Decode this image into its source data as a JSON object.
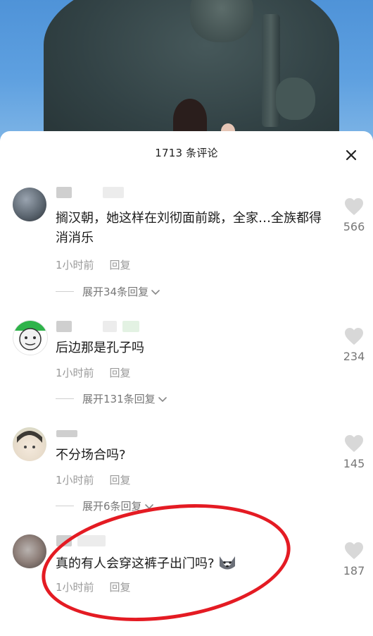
{
  "header": {
    "comment_count_title": "1713 条评论"
  },
  "comments": [
    {
      "text": "搁汉朝，她这样在刘彻面前跳，全家…全族都得消消乐",
      "time": "1小时前",
      "reply_label": "回复",
      "expand_label": "展开34条回复",
      "likes": "566"
    },
    {
      "text": "后边那是孔子吗",
      "time": "1小时前",
      "reply_label": "回复",
      "expand_label": "展开131条回复",
      "likes": "234"
    },
    {
      "text": "不分场合吗?",
      "time": "1小时前",
      "reply_label": "回复",
      "expand_label": "展开6条回复",
      "likes": "145"
    },
    {
      "text": "真的有人会穿这裤子出门吗?",
      "time": "1小时前",
      "reply_label": "回复",
      "likes": "187"
    }
  ],
  "colors": {
    "annotation_circle": "#e41b23",
    "like_icon": "#d8d8d8"
  },
  "icons": {
    "close": "close-icon",
    "like": "heart-icon",
    "expand": "chevron-down-icon",
    "emoji": "dog-emoji"
  }
}
